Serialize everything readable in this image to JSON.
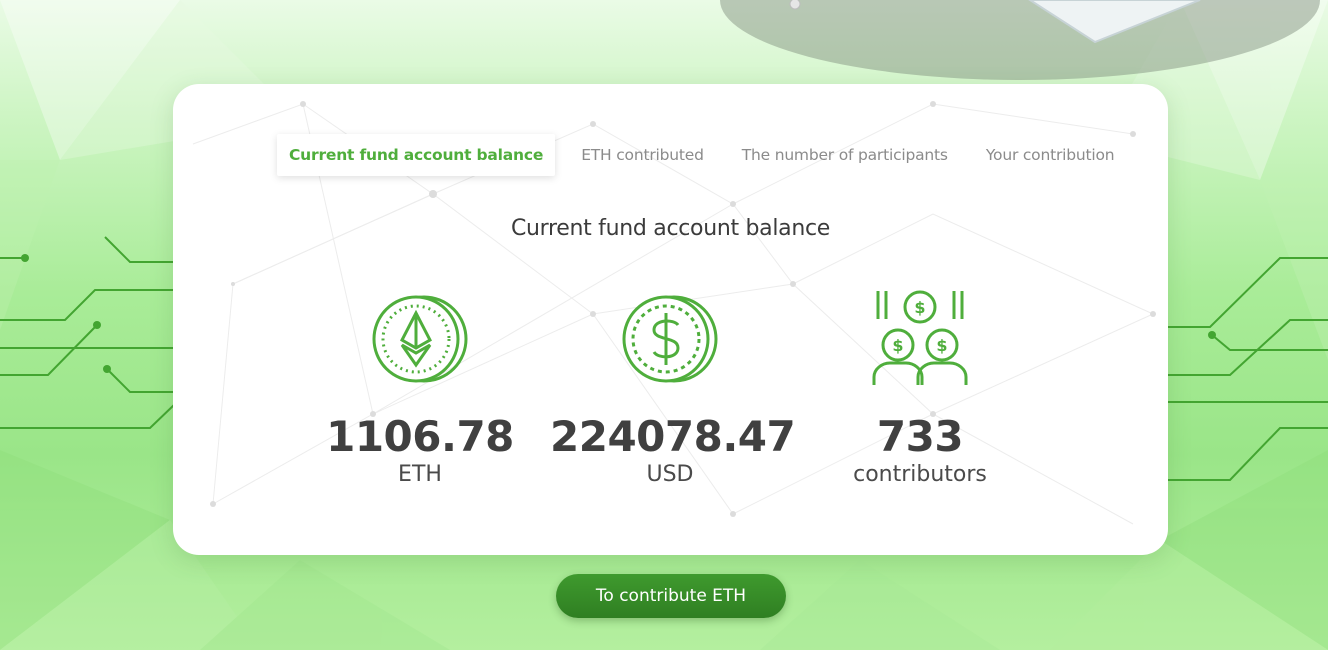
{
  "tabs": [
    {
      "label": "Current fund account balance",
      "active": true
    },
    {
      "label": "ETH contributed",
      "active": false
    },
    {
      "label": "The number of participants",
      "active": false
    },
    {
      "label": "Your contribution",
      "active": false
    }
  ],
  "section_title": "Current fund account balance",
  "stats": [
    {
      "icon": "ethereum-coin-icon",
      "value": "1106.78",
      "unit": "ETH"
    },
    {
      "icon": "dollar-coin-icon",
      "value": "224078.47",
      "unit": "USD"
    },
    {
      "icon": "contributors-icon",
      "value": "733",
      "unit": "contributors"
    }
  ],
  "cta_label": "To contribute ETH",
  "colors": {
    "accent": "#4fae3c",
    "button": "#3a8f2a",
    "text_dark": "#404040",
    "background": "#a9ec98"
  }
}
